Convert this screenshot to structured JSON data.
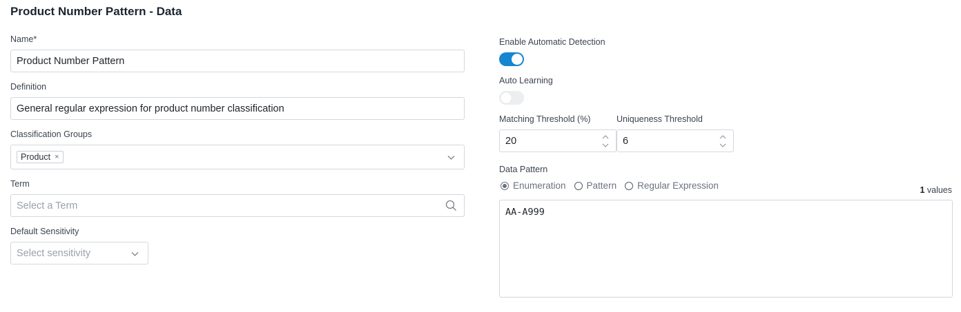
{
  "page": {
    "title": "Product Number Pattern - Data"
  },
  "name": {
    "label": "Name*",
    "value": "Product Number Pattern"
  },
  "definition": {
    "label": "Definition",
    "value": "General regular expression for product number classification"
  },
  "classification_groups": {
    "label": "Classification Groups",
    "tags": [
      "Product"
    ],
    "remove_glyph": "×"
  },
  "term": {
    "label": "Term",
    "placeholder": "Select a Term"
  },
  "default_sensitivity": {
    "label": "Default Sensitivity",
    "placeholder": "Select sensitivity"
  },
  "enable_automatic_detection": {
    "label": "Enable Automatic Detection",
    "enabled": true
  },
  "auto_learning": {
    "label": "Auto Learning",
    "enabled": false
  },
  "matching_threshold": {
    "label": "Matching Threshold (%)",
    "value": "20"
  },
  "uniqueness_threshold": {
    "label": "Uniqueness Threshold",
    "value": "6"
  },
  "data_pattern": {
    "label": "Data Pattern",
    "options": [
      "Enumeration",
      "Pattern",
      "Regular Expression"
    ],
    "selected": "Enumeration",
    "count": "1",
    "count_suffix": " values",
    "values_text": "AA-A999"
  },
  "colors": {
    "accent": "#1586cf",
    "border": "#d3d7dc",
    "placeholder": "#9aa1a9"
  }
}
